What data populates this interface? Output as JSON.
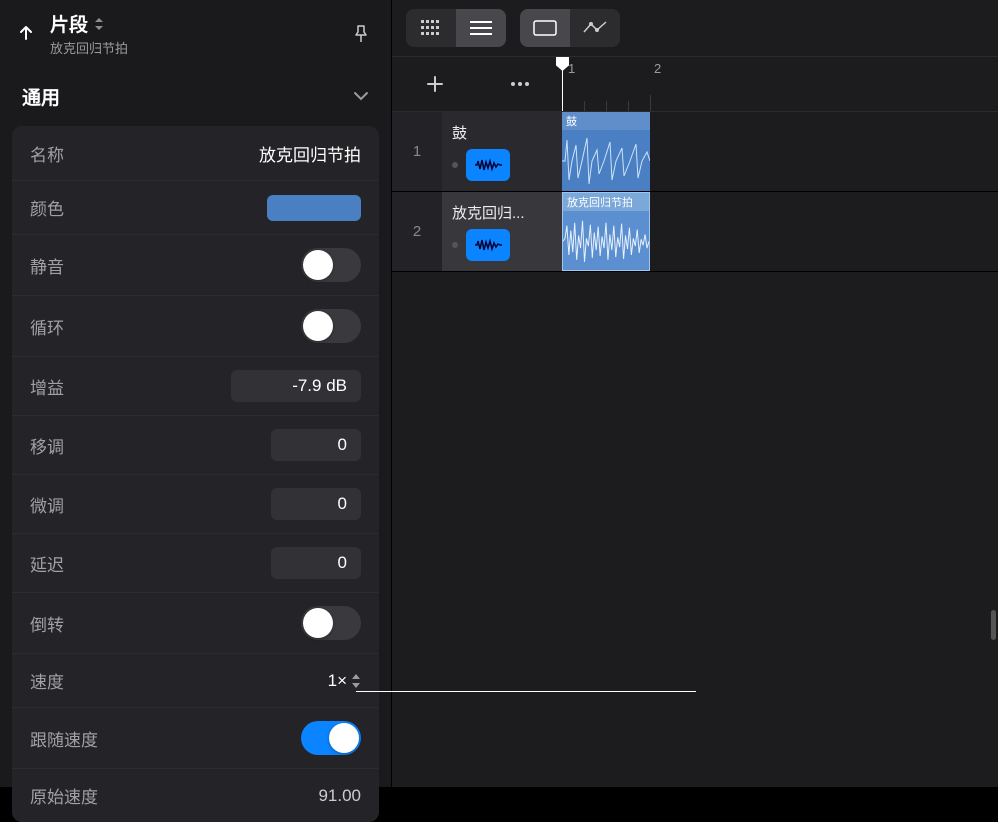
{
  "inspector": {
    "title": "片段",
    "subtitle": "放克回归节拍",
    "section": "通用",
    "rows": {
      "name_label": "名称",
      "name_value": "放克回归节拍",
      "color_label": "颜色",
      "mute_label": "静音",
      "loop_label": "循环",
      "gain_label": "增益",
      "gain_value": "-7.9 dB",
      "transpose_label": "移调",
      "transpose_value": "0",
      "finetune_label": "微调",
      "finetune_value": "0",
      "delay_label": "延迟",
      "delay_value": "0",
      "reverse_label": "倒转",
      "speed_label": "速度",
      "speed_value": "1×",
      "follow_label": "跟随速度",
      "orig_label": "原始速度",
      "orig_value": "91.00"
    }
  },
  "timeline": {
    "markers": [
      "1",
      "2"
    ]
  },
  "tracks": [
    {
      "num": "1",
      "name": "鼓",
      "clip_label": "鼓"
    },
    {
      "num": "2",
      "name": "放克回归...",
      "clip_label": "放克回归节拍"
    }
  ]
}
